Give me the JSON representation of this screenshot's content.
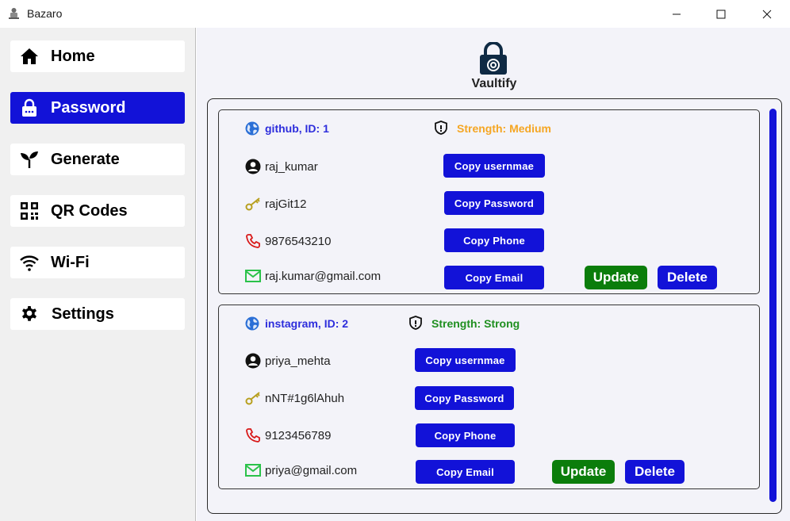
{
  "window": {
    "title": "Bazaro"
  },
  "sidebar": {
    "items": [
      {
        "label": "Home",
        "icon": "home-icon"
      },
      {
        "label": "Password",
        "icon": "lock-icon",
        "active": true
      },
      {
        "label": "Generate",
        "icon": "sprout-icon"
      },
      {
        "label": "QR Codes",
        "icon": "qr-code-icon"
      },
      {
        "label": "Wi-Fi",
        "icon": "wifi-icon"
      },
      {
        "label": "Settings",
        "icon": "gear-icon"
      }
    ]
  },
  "header": {
    "brand": "Vaultify",
    "logo": "padlock-icon"
  },
  "colors": {
    "accent": "#1212d8",
    "update": "#0b7d0b",
    "strength_medium": "#f5a623",
    "strength_strong": "#1f8f1f",
    "site_text": "#2d2ddc"
  },
  "entries": [
    {
      "site": "github, ID: 1",
      "strength": "Strength: Medium",
      "username": "raj_kumar",
      "password": "rajGit12",
      "phone": "9876543210",
      "email": "raj.kumar@gmail.com",
      "copy_username": "Copy usernmae",
      "copy_password": "Copy Password",
      "copy_phone": "Copy Phone",
      "copy_email": "Copy Email",
      "update": "Update",
      "delete": "Delete"
    },
    {
      "site": "instagram, ID: 2",
      "strength": "Strength: Strong",
      "username": "priya_mehta",
      "password": "nNT#1g6lAhuh",
      "phone": "9123456789",
      "email": "priya@gmail.com",
      "copy_username": "Copy usernmae",
      "copy_password": "Copy Password",
      "copy_phone": "Copy Phone",
      "copy_email": "Copy Email",
      "update": "Update",
      "delete": "Delete"
    }
  ]
}
